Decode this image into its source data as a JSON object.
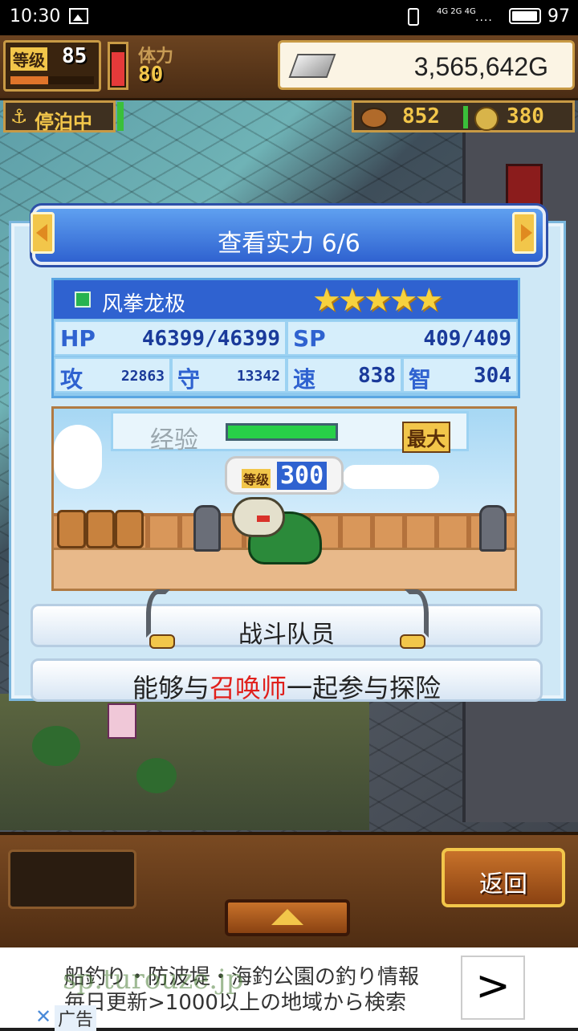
{
  "status_bar": {
    "time": "10:30",
    "network": "4G 2G 4G",
    "signal": "....",
    "battery": "97"
  },
  "hud": {
    "level_label": "等级",
    "level_value": "85",
    "level_progress": 0.45,
    "stamina_label": "体力",
    "stamina_value": "80",
    "stamina_fill": 0.85,
    "gold": "3,565,642G",
    "anchor_label": "停泊中",
    "resource_a": "852",
    "resource_b": "380"
  },
  "dialog": {
    "title": "查看实力 6/6",
    "monster": {
      "name": "风拳龙极",
      "stars": "★★★★★",
      "hp_key": "HP",
      "hp": "46399/46399",
      "sp_key": "SP",
      "sp": "409/409",
      "atk_key": "攻",
      "atk": "22863",
      "def_key": "守",
      "def": "13342",
      "spd_key": "速",
      "spd": "838",
      "int_key": "智",
      "int": "304"
    },
    "exp_label": "经验",
    "exp_fill": 1.0,
    "exp_max": "最大",
    "level_tag_label": "等级",
    "level_tag_value": "300",
    "role": "战斗队员",
    "description_pre": "能够与",
    "description_highlight": "召唤师",
    "description_post": "一起参与探险"
  },
  "bottom": {
    "back_label": "返回"
  },
  "ad": {
    "line1": "船釣り・防波堤・海釣公園の釣り情報",
    "line2": "毎日更新>1000以上の地域から検索",
    "url": "sp.turouze.jp",
    "arrow": ">",
    "close": "✕",
    "tag": "广告"
  },
  "colors": {
    "accent_blue": "#2f62d0",
    "gold": "#f2c64a",
    "highlight_red": "#e0201c",
    "exp_green": "#28d048"
  }
}
